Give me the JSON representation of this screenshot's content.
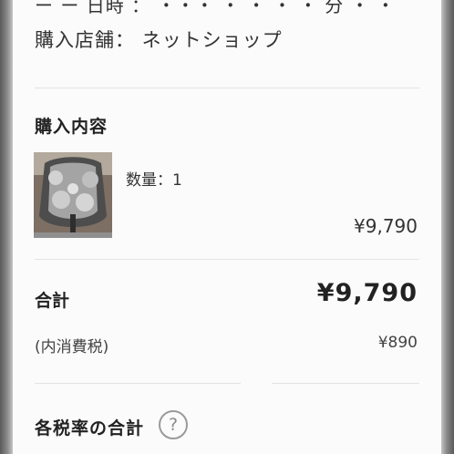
{
  "order": {
    "top_fragment": "ー  ー 日時 ：  ・・・ ・ ・ ・ ・ 分 ・ ・",
    "shop_line": "購入店舗：  ネットショップ"
  },
  "purchase": {
    "title": "購入内容",
    "item_qty": "数量：1",
    "item_price": "¥9,790"
  },
  "totals": {
    "total_label": "合計",
    "total_value": "¥9,790",
    "tax_label": "(内消費税)",
    "tax_value": "¥890"
  },
  "tax_rates": {
    "title": "各税率の合計",
    "help_icon": "?"
  }
}
